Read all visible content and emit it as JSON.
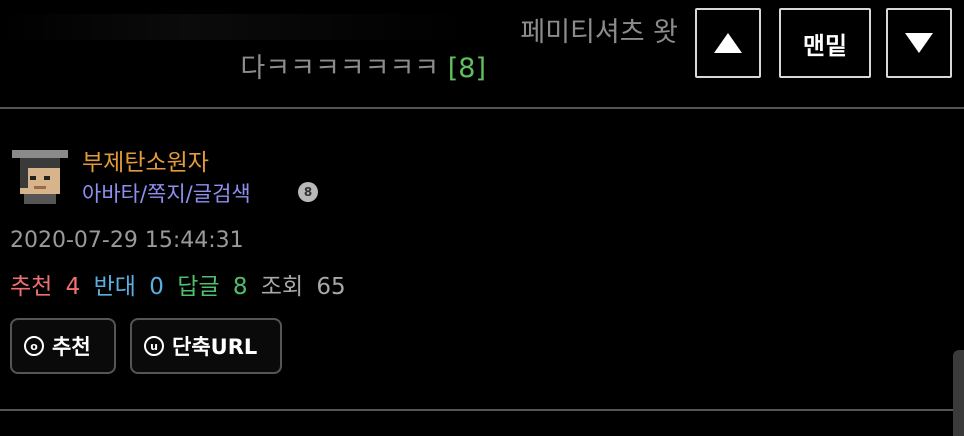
{
  "header": {
    "title_line1": "페미티셔츠 왓",
    "title_line2": "다ㅋㅋㅋㅋㅋㅋㅋ",
    "reply_count": "[8]",
    "nav_bottom_label": "맨밑"
  },
  "author": {
    "name": "부제탄소원자",
    "links": "아바타/쪽지/글검색",
    "level": "8"
  },
  "post": {
    "timestamp": "2020-07-29 15:44:31",
    "stats": {
      "recommend_label": "추천",
      "recommend_count": "4",
      "oppose_label": "반대",
      "oppose_count": "0",
      "reply_label": "답글",
      "reply_count": "8",
      "views_label": "조회",
      "views_count": "65"
    }
  },
  "actions": {
    "recommend_label": "추천",
    "recommend_icon": "o",
    "shorturl_label": "단축URL",
    "shorturl_icon": "u"
  }
}
